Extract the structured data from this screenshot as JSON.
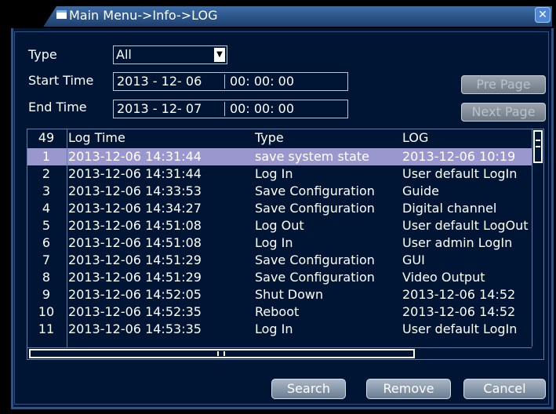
{
  "window": {
    "title": "Main Menu->Info->LOG",
    "close_symbol": "✕",
    "close_icon": "close-icon"
  },
  "filters": {
    "type_label": "Type",
    "type_value": "All",
    "start_label": "Start Time",
    "start_date": "2013 - 12- 06",
    "start_time": "00: 00: 00",
    "end_label": "End Time",
    "end_date": "2013 - 12- 07",
    "end_time": "00: 00: 00"
  },
  "paging": {
    "pre_label": "Pre Page",
    "next_label": "Next Page"
  },
  "table": {
    "count": "49",
    "headers": {
      "time": "Log Time",
      "type": "Type",
      "log": "LOG"
    },
    "rows": [
      {
        "num": "1",
        "time": "2013-12-06 14:31:44",
        "type": "save system state",
        "log": "2013-12-06 10:19",
        "selected": true
      },
      {
        "num": "2",
        "time": "2013-12-06 14:31:44",
        "type": "Log In",
        "log": "User default LogIn"
      },
      {
        "num": "3",
        "time": "2013-12-06 14:33:53",
        "type": "Save Configuration",
        "log": "Guide"
      },
      {
        "num": "4",
        "time": "2013-12-06 14:34:27",
        "type": "Save Configuration",
        "log": "Digital channel"
      },
      {
        "num": "5",
        "time": "2013-12-06 14:51:08",
        "type": "Log Out",
        "log": "User default LogOut"
      },
      {
        "num": "6",
        "time": "2013-12-06 14:51:08",
        "type": "Log In",
        "log": "User admin LogIn"
      },
      {
        "num": "7",
        "time": "2013-12-06 14:51:29",
        "type": "Save Configuration",
        "log": "GUI"
      },
      {
        "num": "8",
        "time": "2013-12-06 14:51:29",
        "type": "Save Configuration",
        "log": "Video Output"
      },
      {
        "num": "9",
        "time": "2013-12-06 14:52:05",
        "type": "Shut Down",
        "log": "2013-12-06 14:52"
      },
      {
        "num": "10",
        "time": "2013-12-06 14:52:35",
        "type": "Reboot",
        "log": "2013-12-06 14:52"
      },
      {
        "num": "11",
        "time": "2013-12-06 14:53:35",
        "type": "Log In",
        "log": "User default LogIn"
      }
    ]
  },
  "buttons": {
    "search": "Search",
    "remove": "Remove",
    "cancel": "Cancel"
  },
  "colors": {
    "background": "#001533",
    "title_bar": "#2b5289",
    "selected_row": "#9a97cf"
  }
}
